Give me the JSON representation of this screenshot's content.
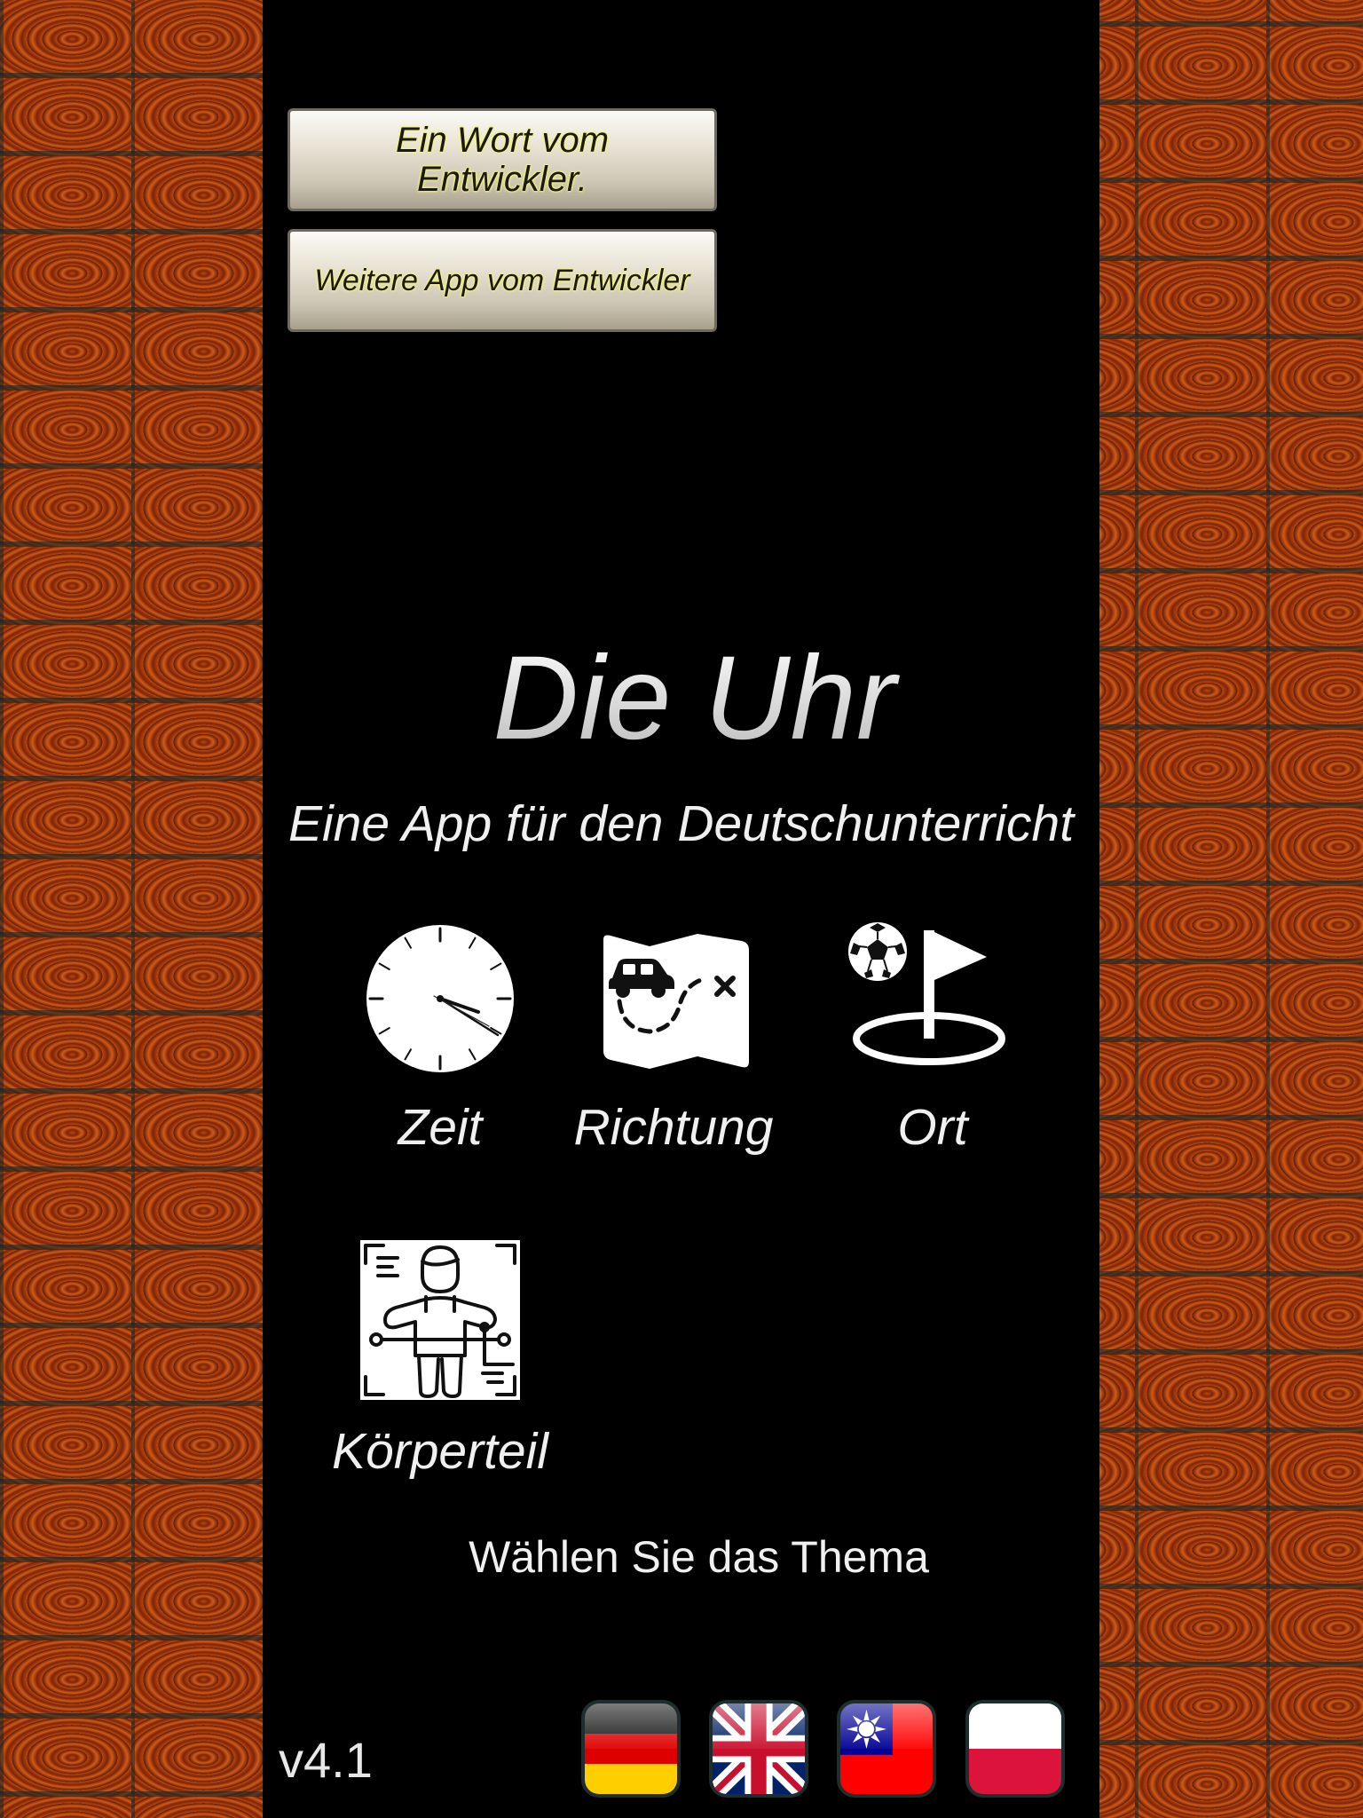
{
  "buttons": {
    "word_from_developer": "Ein Wort vom Entwickler.",
    "more_apps": "Weitere App vom Entwickler"
  },
  "title": "Die Uhr",
  "subtitle": "Eine App für den Deutschunterricht",
  "topics": [
    {
      "label": "Zeit",
      "icon": "clock-icon"
    },
    {
      "label": "Richtung",
      "icon": "map-route-icon"
    },
    {
      "label": "Ort",
      "icon": "ball-flag-icon"
    },
    {
      "label": "Körperteil",
      "icon": "body-parts-icon"
    }
  ],
  "hint": "Wählen Sie das Thema",
  "version": "v4.1",
  "languages": [
    {
      "icon": "flag-germany-icon"
    },
    {
      "icon": "flag-uk-icon"
    },
    {
      "icon": "flag-taiwan-icon"
    },
    {
      "icon": "flag-poland-icon"
    }
  ],
  "colors": {
    "panel_background": "#000000",
    "text": "#f0f0f0",
    "button_glow": "#f2f27a"
  }
}
